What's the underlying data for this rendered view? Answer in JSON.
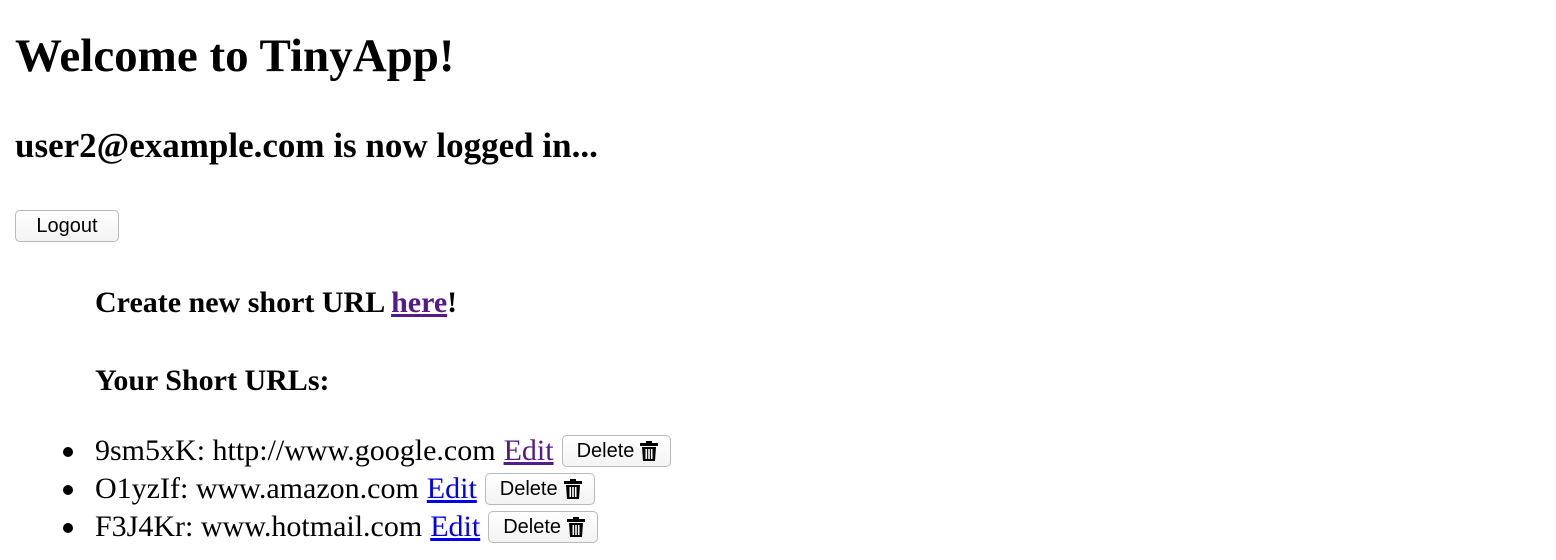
{
  "header": {
    "title": "Welcome to TinyApp!",
    "logged_in_text": "user2@example.com is now logged in...",
    "logout_label": "Logout"
  },
  "create": {
    "prefix": "Create new short URL ",
    "link_label": "here",
    "suffix": "!"
  },
  "list": {
    "heading": "Your Short URLs:",
    "items": [
      {
        "short": "9sm5xK",
        "long": "http://www.google.com",
        "edit_label": "Edit",
        "delete_label": "Delete",
        "edit_visited": true
      },
      {
        "short": "O1yzIf",
        "long": "www.amazon.com",
        "edit_label": "Edit",
        "delete_label": "Delete",
        "edit_visited": false
      },
      {
        "short": "F3J4Kr",
        "long": "www.hotmail.com",
        "edit_label": "Edit",
        "delete_label": "Delete",
        "edit_visited": false
      }
    ]
  },
  "colors": {
    "link": "#0000ee",
    "visited_link": "#551a8b"
  },
  "icons": {
    "delete": "trash-icon"
  }
}
